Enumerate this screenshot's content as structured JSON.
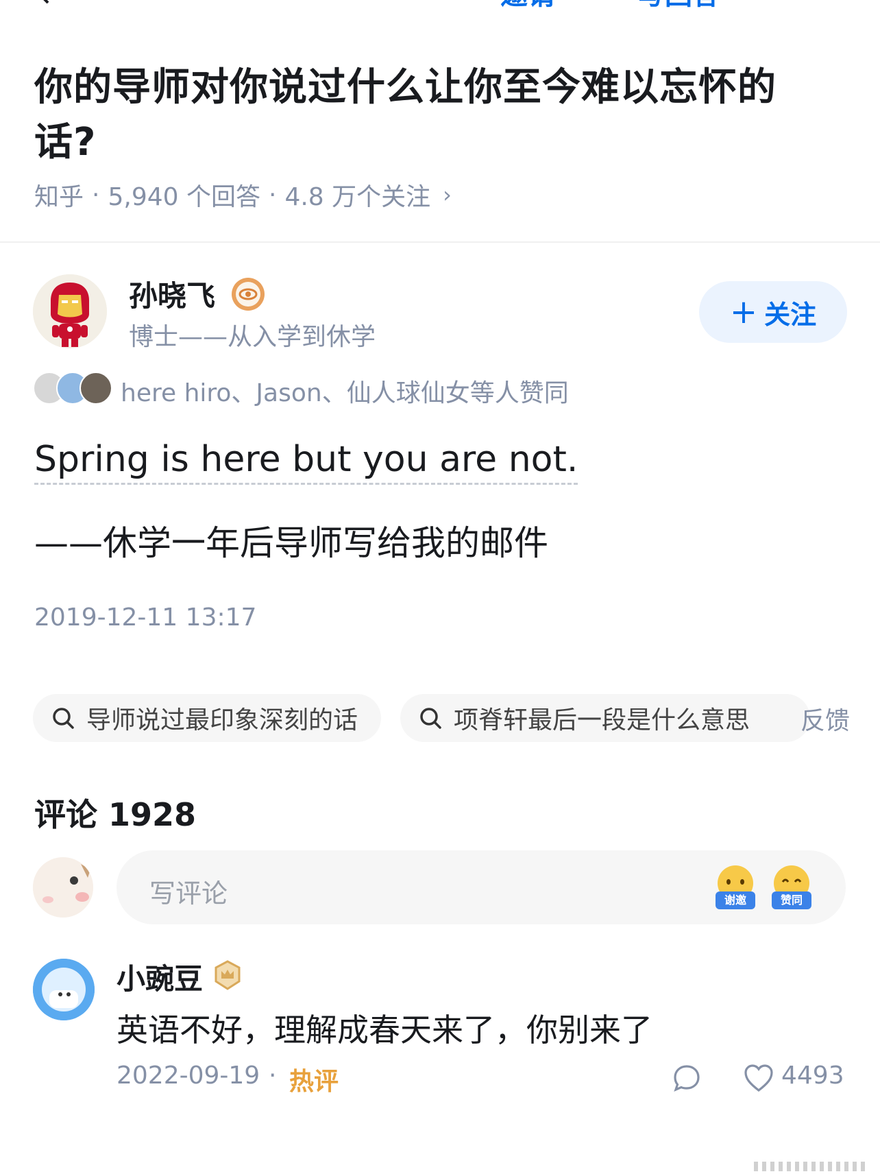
{
  "top_nav": {
    "cut_text_1": "邀请",
    "cut_text_2": "写回答"
  },
  "question": {
    "title": "你的导师对你说过什么让你至今难以忘怀的话?",
    "source": "知乎",
    "answers": "5,940 个回答",
    "followers": "4.8 万个关注",
    "chevron": "›"
  },
  "author": {
    "name": "孙晓飞",
    "description": "博士——从入学到休学",
    "follow_label": "关注",
    "follow_plus": "+"
  },
  "likers": {
    "text": "here hiro、Jason、仙人球仙女等人赞同"
  },
  "answer": {
    "english": "Spring is here but you are not.",
    "chinese": "——休学一年后导师写给我的邮件",
    "time": "2019-12-11 13:17"
  },
  "related_searches": [
    "导师说过最印象深刻的话",
    "项脊轩最后一段是什么意思"
  ],
  "feedback_label": "反馈",
  "comments": {
    "header": "评论 1928",
    "input_placeholder": "写评论",
    "emoji_buttons": [
      "谢邀",
      "赞同"
    ],
    "items": [
      {
        "name": "小豌豆",
        "text": "英语不好，理解成春天来了，你别来了",
        "date": "2022-09-19",
        "separator": "·",
        "tag": "热评",
        "likes": "4493"
      }
    ]
  },
  "colors": {
    "accent": "#056de8",
    "meta_gray": "#8590a6",
    "hot_tag": "#e8a13c",
    "follow_bg": "#ebf3fe"
  }
}
